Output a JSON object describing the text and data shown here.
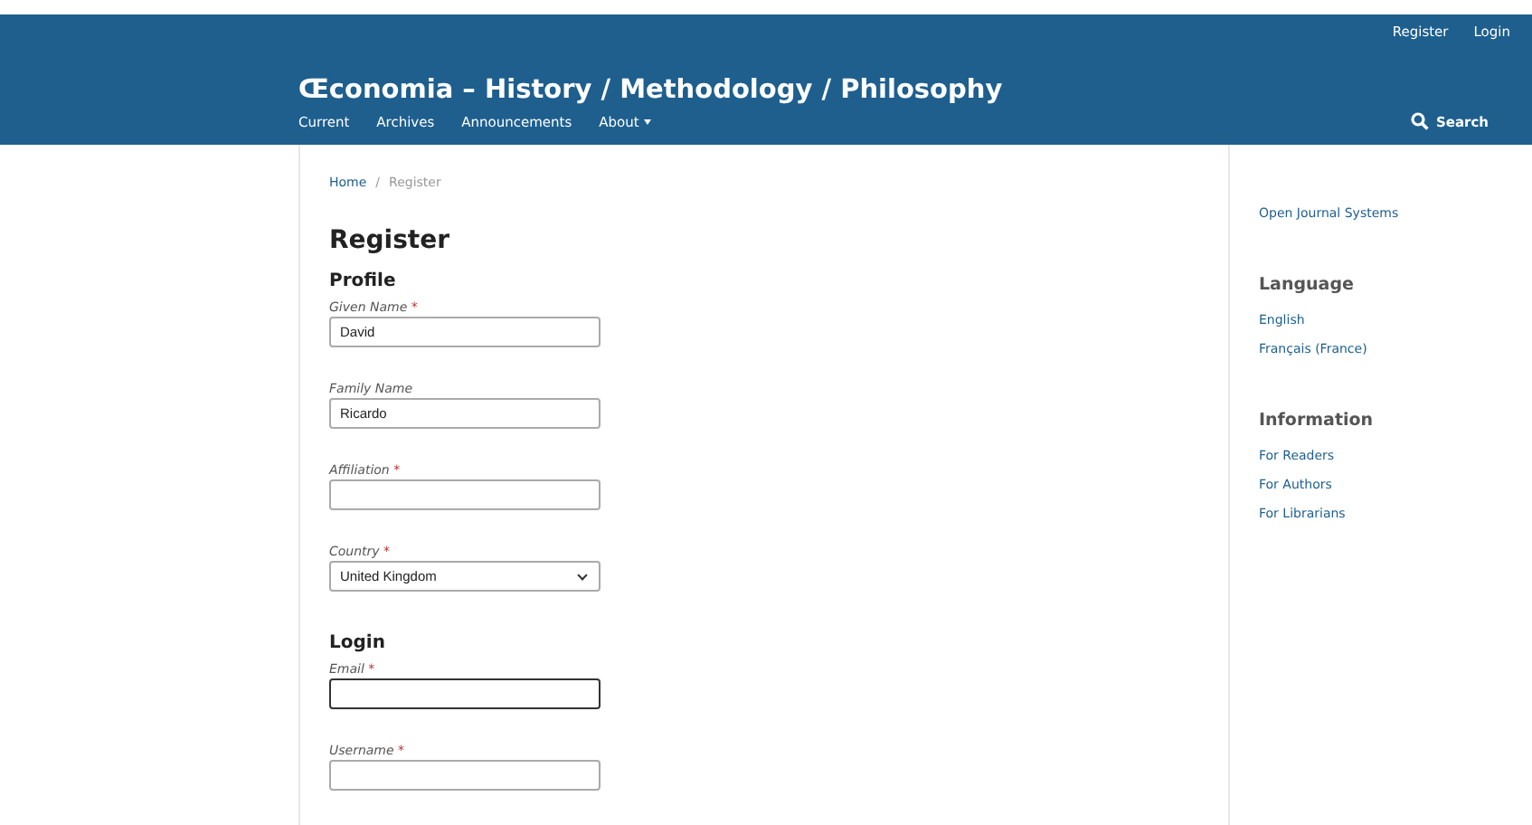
{
  "header": {
    "user_links": [
      "Register",
      "Login"
    ],
    "title": "Œconomia – History / Methodology / Philosophy",
    "nav": [
      {
        "label": "Current",
        "dropdown": false
      },
      {
        "label": "Archives",
        "dropdown": false
      },
      {
        "label": "Announcements",
        "dropdown": false
      },
      {
        "label": "About",
        "dropdown": true
      }
    ],
    "search": "Search"
  },
  "breadcrumb": [
    "Home",
    "Register"
  ],
  "breadcrumb_separator": "/",
  "heading": "Register",
  "sections": [
    {
      "title": "Profile",
      "fields": [
        {
          "kind": "text",
          "label": "Given Name",
          "required": true,
          "value": "David",
          "focused": false
        },
        {
          "kind": "text",
          "label": "Family Name",
          "required": false,
          "value": "Ricardo",
          "focused": false
        },
        {
          "kind": "text",
          "label": "Affiliation",
          "required": true,
          "focused": false
        },
        {
          "kind": "select",
          "label": "Country",
          "required": true,
          "value": "United Kingdom",
          "focused": false
        }
      ]
    },
    {
      "title": "Login",
      "fields": [
        {
          "kind": "text",
          "label": "Email",
          "required": true,
          "focused": true
        },
        {
          "kind": "text",
          "label": "Username",
          "required": true,
          "focused": false
        }
      ]
    }
  ],
  "required_mark": "*",
  "sidebar": [
    {
      "links": [
        "Open Journal Systems"
      ]
    },
    {
      "title": "Language",
      "links": [
        "English",
        "Français (France)"
      ]
    },
    {
      "title": "Information",
      "links": [
        "For Readers",
        "For Authors",
        "For Librarians"
      ]
    }
  ]
}
